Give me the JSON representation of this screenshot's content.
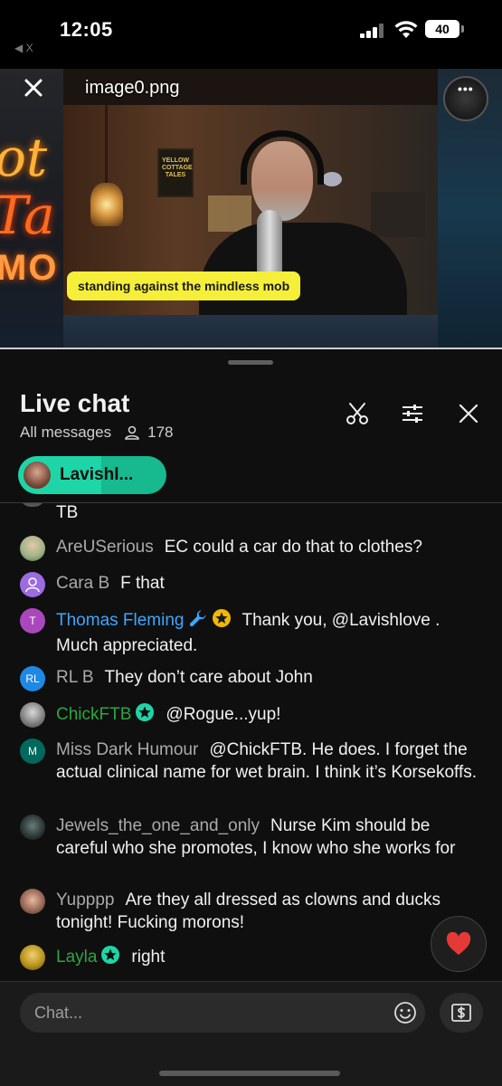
{
  "status_bar": {
    "time": "12:05",
    "back_label": "◀ X",
    "battery": "40"
  },
  "viewer": {
    "file_name": "image0.png",
    "more_label": "•••",
    "neon_lines": [
      "ot",
      "Ta",
      "MO"
    ],
    "poster_text": "YELLOW COTTAGE TALES",
    "caption": "standing against the mindless mob"
  },
  "chat": {
    "title": "Live chat",
    "filter_label": "All messages",
    "viewer_count": "178",
    "pinned_chip_label": "Lavishl...",
    "fragment_text": "TB",
    "messages": [
      {
        "author": "AreUSerious",
        "text": "EC could a car do that to clothes?",
        "avatar_initials": "",
        "avatar_color": "#6b8e5a"
      },
      {
        "author": "Cara B",
        "text": "F that",
        "avatar_initials": "",
        "avatar_color": "#9b6be0"
      },
      {
        "author": "Thomas Fleming",
        "text": "Thank you, @Lavishlove . Much appreciated.",
        "avatar_initials": "T",
        "avatar_color": "#ab47bc"
      },
      {
        "author": "RL B",
        "text": "They don’t care about John",
        "avatar_initials": "RL",
        "avatar_color": "#1e88e5"
      },
      {
        "author": "ChickFTB",
        "text": "@Rogue...yup!",
        "avatar_initials": "",
        "avatar_color": "#777777"
      },
      {
        "author": "Miss Dark Humour",
        "text": "@ChickFTB. He does. I forget the actual clinical name for wet brain. I think it’s Korsekoffs.",
        "avatar_initials": "M",
        "avatar_color": "#00695c"
      },
      {
        "author": "Jewels_the_one_and_only",
        "text": "Nurse Kim should be careful who she promotes, I know who she works for",
        "avatar_initials": "",
        "avatar_color": "#3a4a4a"
      },
      {
        "author": "Yupppp",
        "text": "Are they all dressed as clowns and ducks tonight! Fucking morons!",
        "avatar_initials": "",
        "avatar_color": "#8a6a5a"
      },
      {
        "author": "Layla",
        "text": "right",
        "avatar_initials": "",
        "avatar_color": "#b8941c"
      }
    ],
    "input_placeholder": "Chat..."
  },
  "colors": {
    "owner_name": "#3ea6ff",
    "member_name": "#2ba640",
    "pinned_chip": "#1ed5a7",
    "heart": "#e53935"
  }
}
